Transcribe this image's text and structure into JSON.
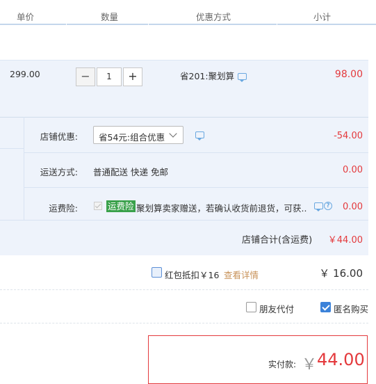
{
  "header": {
    "col_price": "单价",
    "col_qty": "数量",
    "col_discount": "优惠方式",
    "col_subtotal": "小计"
  },
  "item": {
    "price": "299.00",
    "qty_minus": "−",
    "qty_value": "1",
    "qty_plus": "+",
    "discount": "省201:聚划算",
    "subtotal": "98.00"
  },
  "shop": {
    "coupon_label": "店铺优惠:",
    "coupon_selected": "省54元:组合优惠",
    "coupon_amount": "-54.00",
    "shipping_label": "运送方式:",
    "shipping_value": "普通配送 快递 免邮",
    "shipping_amount": "0.00",
    "insurance_label": "运费险:",
    "insurance_badge": "运费险",
    "insurance_text": "聚划算卖家赠送，若确认收货前退货，可获...",
    "insurance_amount": "0.00",
    "total_label": "店铺合计(含运费)",
    "total_value": "￥44.00"
  },
  "redpacket": {
    "label": "红包抵扣￥16",
    "details_link": "查看详情",
    "amount": "￥ 16.00"
  },
  "options": {
    "friend_pay": "朋友代付",
    "anonymous": "匿名购买"
  },
  "payment": {
    "label": "实付款:",
    "currency": "￥",
    "amount": "44.00"
  },
  "colors": {
    "accent_red": "#e4393c",
    "link_blue": "#3b82d9",
    "row_bg": "#eef3fb",
    "badge_green": "#3aa14b"
  }
}
